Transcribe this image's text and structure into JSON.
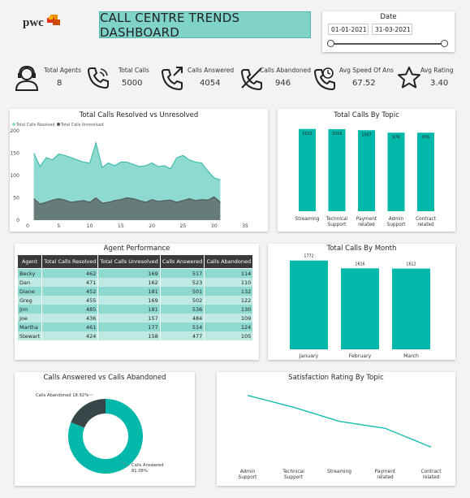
{
  "logo": {
    "text": "pwc"
  },
  "header": {
    "title": "CALL CENTRE TRENDS DASHBOARD"
  },
  "date_slicer": {
    "label": "Date",
    "start": "01-01-2021",
    "end": "31-03-2021"
  },
  "kpis": [
    {
      "label": "Total Agents",
      "value": "8",
      "icon": "agent-headset-icon"
    },
    {
      "label": "Total Calls",
      "value": "5000",
      "icon": "phone-icon"
    },
    {
      "label": "Calls Answered",
      "value": "4054",
      "icon": "phone-answered-icon"
    },
    {
      "label": "Calls Abandoned",
      "value": "946",
      "icon": "phone-abandoned-icon"
    },
    {
      "label": "Avg Speed Of Ans",
      "value": "67.52",
      "icon": "phone-clock-icon"
    },
    {
      "label": "Avg Rating",
      "value": "3.40",
      "icon": "star-icon"
    }
  ],
  "resolved_chart": {
    "title": "Total Calls Resolved vs Unresolved",
    "legend": [
      "Total Calls Resolved",
      "Total Calls Unresolved"
    ],
    "colors": {
      "resolved": "#8fdad0",
      "unresolved": "#4f5a59",
      "resolved_line": "#2fb6a8"
    },
    "yticks": [
      "200",
      "150",
      "100",
      "50",
      "0"
    ],
    "xticks": [
      "0",
      "5",
      "10",
      "15",
      "20",
      "25",
      "30",
      "35"
    ]
  },
  "topic_chart": {
    "title": "Total Calls By Topic",
    "categories": [
      "Streaming",
      "Technical Support",
      "Payment related",
      "Admin Support",
      "Contract related"
    ],
    "category_lines": [
      [
        "Streaming"
      ],
      [
        "Technical",
        "Support"
      ],
      [
        "Payment",
        "related"
      ],
      [
        "Admin",
        "Support"
      ],
      [
        "Contract",
        "related"
      ]
    ],
    "values": [
      "1022",
      "1019",
      "1007",
      "976",
      "976"
    ]
  },
  "agent_table": {
    "title": "Agent Performance",
    "columns": [
      "Agent",
      "Total Calls Resolved",
      "Total Calls Unresolved",
      "Calls Answered",
      "Calls Abandoned"
    ],
    "rows": [
      [
        "Becky",
        "462",
        "169",
        "517",
        "114"
      ],
      [
        "Dan",
        "471",
        "162",
        "523",
        "110"
      ],
      [
        "Diane",
        "452",
        "181",
        "501",
        "132"
      ],
      [
        "Greg",
        "455",
        "169",
        "502",
        "122"
      ],
      [
        "Jim",
        "485",
        "181",
        "536",
        "130"
      ],
      [
        "Joe",
        "436",
        "157",
        "484",
        "109"
      ],
      [
        "Martha",
        "461",
        "177",
        "514",
        "124"
      ],
      [
        "Stewart",
        "424",
        "158",
        "477",
        "105"
      ]
    ]
  },
  "month_chart": {
    "title": "Total Calls By Month",
    "categories": [
      "January",
      "February",
      "March"
    ],
    "values": [
      "1772",
      "1616",
      "1612"
    ]
  },
  "donut_chart": {
    "title": "Calls Answered vs Calls Abandoned",
    "abandoned_label": "Calls Abandoned 18.92%",
    "answered_label_1": "Calls Answered",
    "answered_label_2": "81.08%",
    "colors": {
      "answered": "#01b8aa",
      "abandoned": "#374649"
    }
  },
  "rating_chart": {
    "title": "Satisfaction Rating By Topic",
    "category_lines": [
      [
        "Admin",
        "Support"
      ],
      [
        "Technical",
        "Support"
      ],
      [
        "Streaming"
      ],
      [
        "Payment",
        "related"
      ],
      [
        "Contract",
        "related"
      ]
    ]
  },
  "theme": {
    "teal": "#01b8aa",
    "teal_light": "#8fdad0",
    "dark": "#3a3a3a"
  },
  "chart_data": [
    {
      "type": "area",
      "title": "Total Calls Resolved vs Unresolved",
      "xlim": [
        0,
        35
      ],
      "ylim": [
        0,
        200
      ],
      "series": [
        {
          "name": "Total Calls Resolved",
          "x": [
            1,
            2,
            3,
            4,
            5,
            6,
            7,
            8,
            9,
            10,
            11,
            12,
            13,
            14,
            15,
            16,
            17,
            18,
            19,
            20,
            21,
            22,
            23,
            24,
            25,
            26,
            27,
            28,
            29,
            30,
            31
          ],
          "values": [
            150,
            120,
            140,
            135,
            148,
            145,
            140,
            135,
            130,
            128,
            173,
            118,
            128,
            122,
            130,
            130,
            125,
            120,
            122,
            128,
            120,
            122,
            115,
            140,
            145,
            135,
            130,
            128,
            110,
            95,
            90
          ]
        },
        {
          "name": "Total Calls Unresolved",
          "x": [
            1,
            2,
            3,
            4,
            5,
            6,
            7,
            8,
            9,
            10,
            11,
            12,
            13,
            14,
            15,
            16,
            17,
            18,
            19,
            20,
            21,
            22,
            23,
            24,
            25,
            26,
            27,
            28,
            29,
            30,
            31
          ],
          "values": [
            48,
            36,
            40,
            45,
            48,
            45,
            40,
            42,
            44,
            40,
            50,
            38,
            40,
            44,
            46,
            50,
            48,
            44,
            40,
            46,
            42,
            44,
            45,
            40,
            44,
            48,
            44,
            46,
            45,
            52,
            40
          ]
        }
      ]
    },
    {
      "type": "bar",
      "title": "Total Calls By Topic",
      "categories": [
        "Streaming",
        "Technical Support",
        "Payment related",
        "Admin Support",
        "Contract related"
      ],
      "values": [
        1022,
        1019,
        1007,
        976,
        976
      ],
      "ylim": [
        0,
        1050
      ]
    },
    {
      "type": "table",
      "title": "Agent Performance"
    },
    {
      "type": "bar",
      "title": "Total Calls By Month",
      "categories": [
        "January",
        "February",
        "March"
      ],
      "values": [
        1772,
        1616,
        1612
      ],
      "ylim": [
        0,
        1800
      ]
    },
    {
      "type": "pie",
      "title": "Calls Answered vs Calls Abandoned",
      "categories": [
        "Calls Answered",
        "Calls Abandoned"
      ],
      "values": [
        81.08,
        18.92
      ]
    },
    {
      "type": "line",
      "title": "Satisfaction Rating By Topic",
      "categories": [
        "Admin Support",
        "Technical Support",
        "Streaming",
        "Payment related",
        "Contract related"
      ],
      "values": [
        3.5,
        3.45,
        3.39,
        3.36,
        3.28
      ],
      "ylim": [
        3.25,
        3.52
      ]
    }
  ]
}
